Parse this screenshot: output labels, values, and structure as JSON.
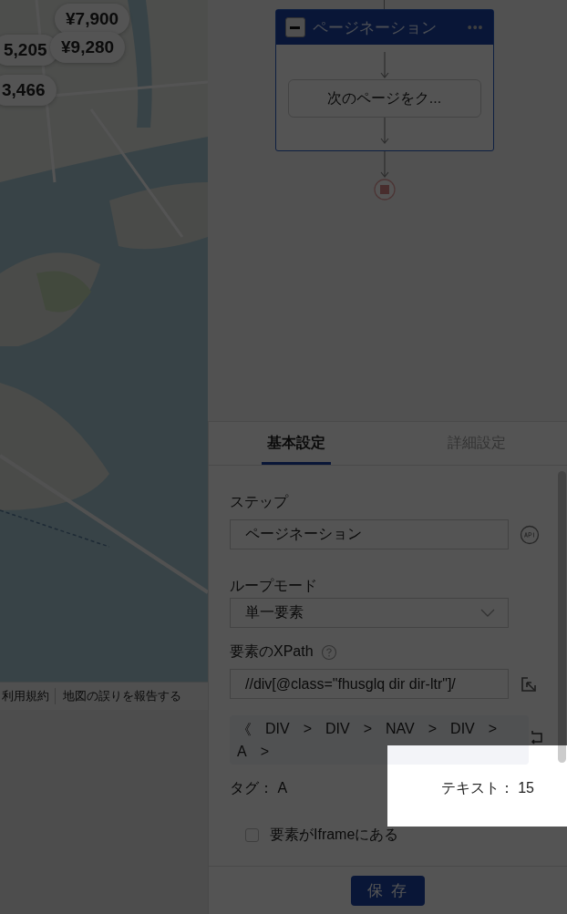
{
  "map": {
    "pins": [
      {
        "price": "¥7,900"
      },
      {
        "price": "5,205"
      },
      {
        "price": "¥9,280"
      },
      {
        "price": "3,466"
      }
    ],
    "footer_links": [
      "利用規約",
      "地図の誤りを報告する"
    ]
  },
  "flow": {
    "loop": {
      "title": "ページネーション",
      "menu": "•••",
      "expanded": true,
      "steps": [
        "次のページをク..."
      ]
    }
  },
  "tabs": [
    {
      "label": "基本設定",
      "selected": true
    },
    {
      "label": "詳細設定",
      "selected": false
    }
  ],
  "form": {
    "step_label": "ステップ",
    "step_value": "ページネーション",
    "loop_mode_label": "ループモード",
    "loop_mode_value": "単一要素",
    "xpath_label": "要素のXPath",
    "xpath_value": "//div[@class=\"fhusglq dir dir-ltr\"]/",
    "breadcrumb": {
      "back": "《",
      "items": [
        {
          "tag": "DIV",
          "sep": ">"
        },
        {
          "tag": "DIV",
          "sep": ">"
        },
        {
          "tag": "NAV",
          "sep": ">"
        },
        {
          "tag": "DIV",
          "sep": ">"
        },
        {
          "tag": "A",
          "sep": ">"
        }
      ]
    },
    "tag_label": "タグ：",
    "tag_value": "A",
    "text_label": "テキスト：",
    "text_value": "15",
    "iframe_label": "要素がIframeにある",
    "iframe_checked": false
  },
  "save_button": "保 存",
  "spotlight": {
    "on": true
  }
}
